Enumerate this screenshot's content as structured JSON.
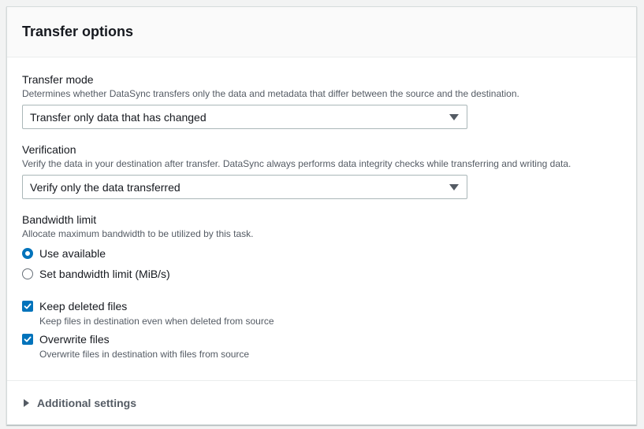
{
  "panel": {
    "title": "Transfer options"
  },
  "transfer_mode": {
    "label": "Transfer mode",
    "description": "Determines whether DataSync transfers only the data and metadata that differ between the source and the destination.",
    "selected": "Transfer only data that has changed"
  },
  "verification": {
    "label": "Verification",
    "description": "Verify the data in your destination after transfer. DataSync always performs data integrity checks while transferring and writing data.",
    "selected": "Verify only the data transferred"
  },
  "bandwidth": {
    "label": "Bandwidth limit",
    "description": "Allocate maximum bandwidth to be utilized by this task.",
    "options": [
      {
        "label": "Use available",
        "selected": true
      },
      {
        "label": "Set bandwidth limit (MiB/s)",
        "selected": false
      }
    ]
  },
  "checkboxes": [
    {
      "label": "Keep deleted files",
      "description": "Keep files in destination even when deleted from source",
      "checked": true
    },
    {
      "label": "Overwrite files",
      "description": "Overwrite files in destination with files from source",
      "checked": true
    }
  ],
  "additional": {
    "label": "Additional settings",
    "expanded": false
  },
  "colors": {
    "accent": "#0073bb",
    "text": "#16191f",
    "muted": "#545b64"
  },
  "icons": [
    "caret-down-icon",
    "checkmark-icon",
    "expand-triangle-icon"
  ]
}
